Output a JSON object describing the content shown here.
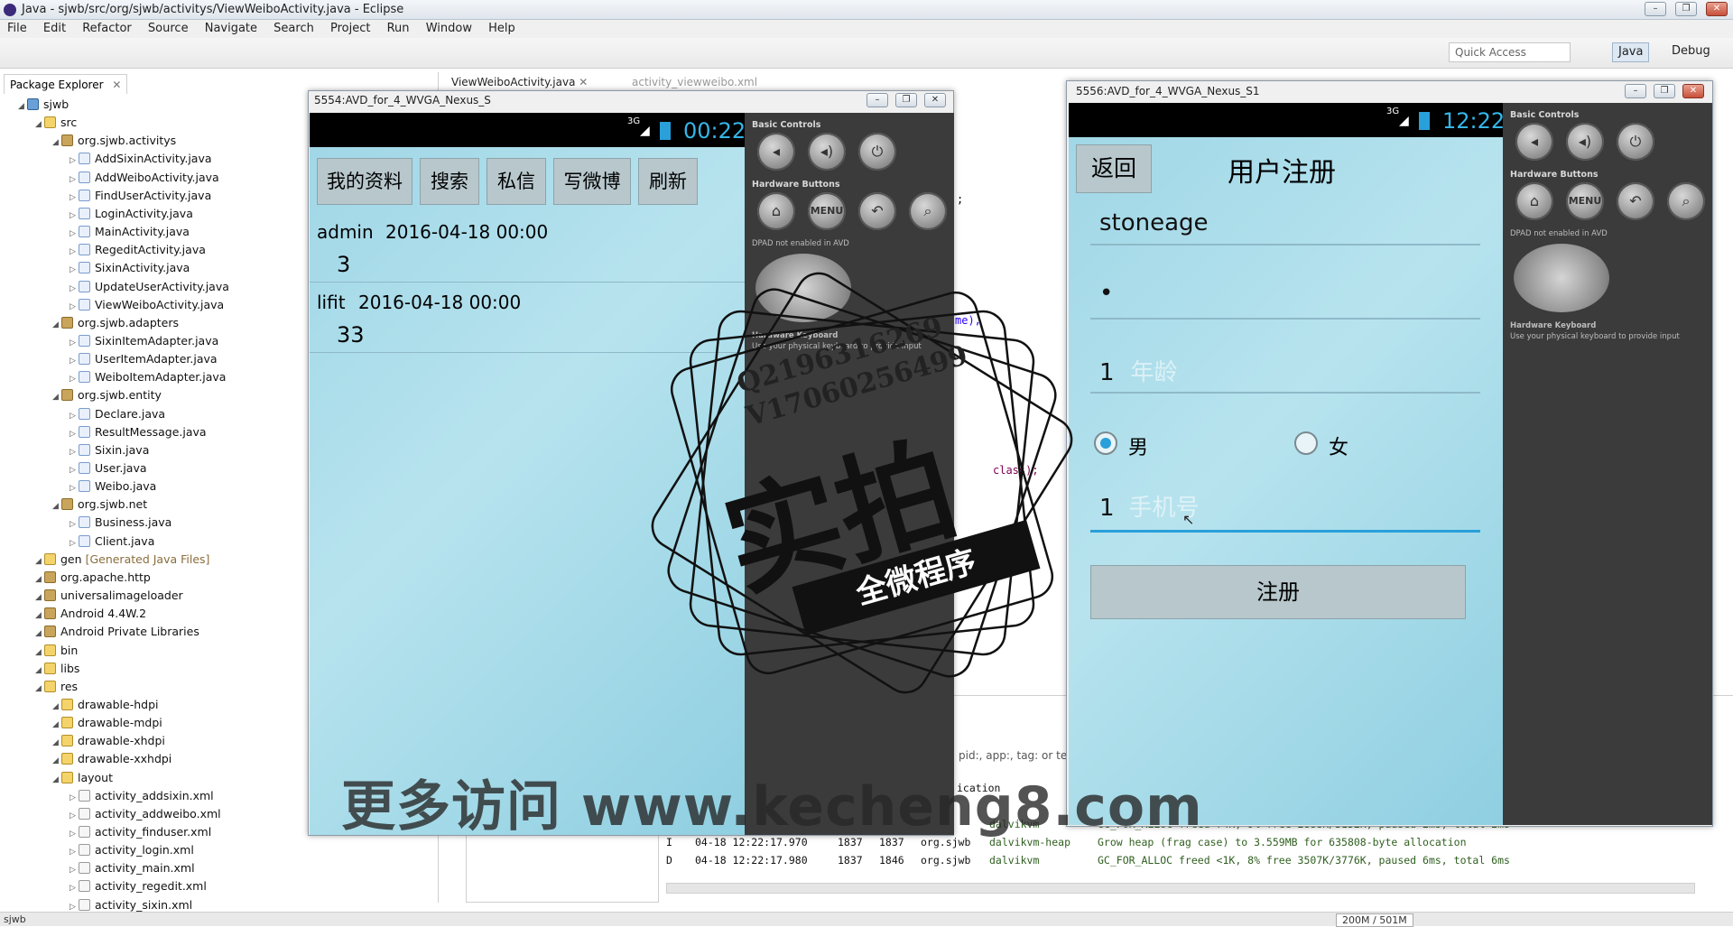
{
  "window": {
    "title": "Java - sjwb/src/org/sjwb/activitys/ViewWeiboActivity.java - Eclipse"
  },
  "menu": [
    "File",
    "Edit",
    "Refactor",
    "Source",
    "Navigate",
    "Search",
    "Project",
    "Run",
    "Window",
    "Help"
  ],
  "toolbar": {
    "quick_access": "Quick Access",
    "persp_java": "Java",
    "persp_debug": "Debug"
  },
  "explorer": {
    "tab": "Package Explorer",
    "items": [
      {
        "label": "sjwb",
        "kind": "project",
        "level": 0
      },
      {
        "label": "src",
        "kind": "folder",
        "level": 1
      },
      {
        "label": "org.sjwb.activitys",
        "kind": "package",
        "level": 2
      },
      {
        "label": "AddSixinActivity.java",
        "kind": "java",
        "level": 3
      },
      {
        "label": "AddWeiboActivity.java",
        "kind": "java",
        "level": 3
      },
      {
        "label": "FindUserActivity.java",
        "kind": "java",
        "level": 3
      },
      {
        "label": "LoginActivity.java",
        "kind": "java",
        "level": 3
      },
      {
        "label": "MainActivity.java",
        "kind": "java",
        "level": 3
      },
      {
        "label": "RegeditActivity.java",
        "kind": "java",
        "level": 3
      },
      {
        "label": "SixinActivity.java",
        "kind": "java",
        "level": 3
      },
      {
        "label": "UpdateUserActivity.java",
        "kind": "java",
        "level": 3
      },
      {
        "label": "ViewWeiboActivity.java",
        "kind": "java",
        "level": 3
      },
      {
        "label": "org.sjwb.adapters",
        "kind": "package",
        "level": 2
      },
      {
        "label": "SixinItemAdapter.java",
        "kind": "java",
        "level": 3
      },
      {
        "label": "UserItemAdapter.java",
        "kind": "java",
        "level": 3
      },
      {
        "label": "WeiboItemAdapter.java",
        "kind": "java",
        "level": 3
      },
      {
        "label": "org.sjwb.entity",
        "kind": "package",
        "level": 2
      },
      {
        "label": "Declare.java",
        "kind": "java",
        "level": 3
      },
      {
        "label": "ResultMessage.java",
        "kind": "java",
        "level": 3
      },
      {
        "label": "Sixin.java",
        "kind": "java",
        "level": 3
      },
      {
        "label": "User.java",
        "kind": "java",
        "level": 3
      },
      {
        "label": "Weibo.java",
        "kind": "java",
        "level": 3
      },
      {
        "label": "org.sjwb.net",
        "kind": "package",
        "level": 2
      },
      {
        "label": "Business.java",
        "kind": "java",
        "level": 3
      },
      {
        "label": "Client.java",
        "kind": "java",
        "level": 3
      },
      {
        "label": "gen",
        "kind": "folder",
        "level": 1,
        "suffix": "[Generated Java Files]"
      },
      {
        "label": "org.apache.http",
        "kind": "package",
        "level": 1
      },
      {
        "label": "universalimageloader",
        "kind": "package",
        "level": 1
      },
      {
        "label": "Android 4.4W.2",
        "kind": "lib",
        "level": 1
      },
      {
        "label": "Android Private Libraries",
        "kind": "lib",
        "level": 1
      },
      {
        "label": "bin",
        "kind": "folder",
        "level": 1
      },
      {
        "label": "libs",
        "kind": "folder",
        "level": 1
      },
      {
        "label": "res",
        "kind": "folder",
        "level": 1
      },
      {
        "label": "drawable-hdpi",
        "kind": "folder",
        "level": 2
      },
      {
        "label": "drawable-mdpi",
        "kind": "folder",
        "level": 2
      },
      {
        "label": "drawable-xhdpi",
        "kind": "folder",
        "level": 2
      },
      {
        "label": "drawable-xxhdpi",
        "kind": "folder",
        "level": 2
      },
      {
        "label": "layout",
        "kind": "folder",
        "level": 2
      },
      {
        "label": "activity_addsixin.xml",
        "kind": "xml",
        "level": 3
      },
      {
        "label": "activity_addweibo.xml",
        "kind": "xml",
        "level": 3
      },
      {
        "label": "activity_finduser.xml",
        "kind": "xml",
        "level": 3
      },
      {
        "label": "activity_login.xml",
        "kind": "xml",
        "level": 3
      },
      {
        "label": "activity_main.xml",
        "kind": "xml",
        "level": 3
      },
      {
        "label": "activity_regedit.xml",
        "kind": "xml",
        "level": 3
      },
      {
        "label": "activity_sixin.xml",
        "kind": "xml",
        "level": 3
      }
    ]
  },
  "editor": {
    "tab1": "ViewWeiboActivity.java",
    "tab2": "activity_viewweibo.xml",
    "frag1": "me),",
    "frag2": "class);",
    "frag3": ";"
  },
  "console": {
    "filter_hint": "pid:, app:, tag: or tex",
    "partial": "ication",
    "rows": [
      {
        "level": "",
        "time": "",
        "pid": "",
        "tid": "",
        "app": "sjwb",
        "tag": "dalvikvm",
        "text": "GC_FOR_ALLOC freed 74K, 9% free 2888K/3152K, paused 2ms, total 2ms"
      },
      {
        "level": "I",
        "time": "04-18 12:22:17.970",
        "pid": "1837",
        "tid": "1837",
        "app": "org.sjwb",
        "tag": "dalvikvm-heap",
        "text": "Grow heap (frag case) to 3.559MB for 635808-byte allocation"
      },
      {
        "level": "D",
        "time": "04-18 12:22:17.980",
        "pid": "1837",
        "tid": "1846",
        "app": "org.sjwb",
        "tag": "dalvikvm",
        "text": "GC_FOR_ALLOC freed <1K, 8% free 3507K/3776K, paused 6ms, total 6ms"
      }
    ]
  },
  "status": {
    "left": "sjwb",
    "mem1": "200M",
    "mem2": "501M"
  },
  "emu1": {
    "title": "5554:AVD_for_4_WVGA_Nexus_S",
    "network": "3G",
    "clock": "00:22",
    "buttons": [
      "我的资料",
      "搜索",
      "私信",
      "写微博",
      "刷新"
    ],
    "posts": [
      {
        "user": "admin",
        "date": "2016-04-18 00:00",
        "content": "3"
      },
      {
        "user": "lifit",
        "date": "2016-04-18 00:00",
        "content": "33"
      }
    ]
  },
  "emu2": {
    "title": "5556:AVD_for_4_WVGA_Nexus_S1",
    "network": "3G",
    "clock": "12:22",
    "back": "返回",
    "heading": "用户注册",
    "username": "stoneage",
    "password": "•",
    "age": "1",
    "gender_male": "男",
    "gender_female": "女",
    "gender_selected": "男",
    "last_field": "1",
    "last_field_hint": "手机号",
    "age_hint": "年龄",
    "submit": "注册"
  },
  "panel": {
    "basic": "Basic Controls",
    "hardware": "Hardware Buttons",
    "dpad": "DPAD not enabled in AVD",
    "keyboard": "Hardware Keyboard",
    "keyboard_hint": "Use your physical keyboard to provide input",
    "menu": "MENU"
  },
  "watermark": {
    "line1": "Q2196316269",
    "line2": "V17060256499",
    "big": "实拍",
    "banner": "全微程序",
    "url": "更多访问 www.kecheng8.com"
  },
  "colors": {
    "accent": "#29a0da",
    "phone_bg": "#9fd6e6",
    "panel": "#3b3b3b"
  }
}
